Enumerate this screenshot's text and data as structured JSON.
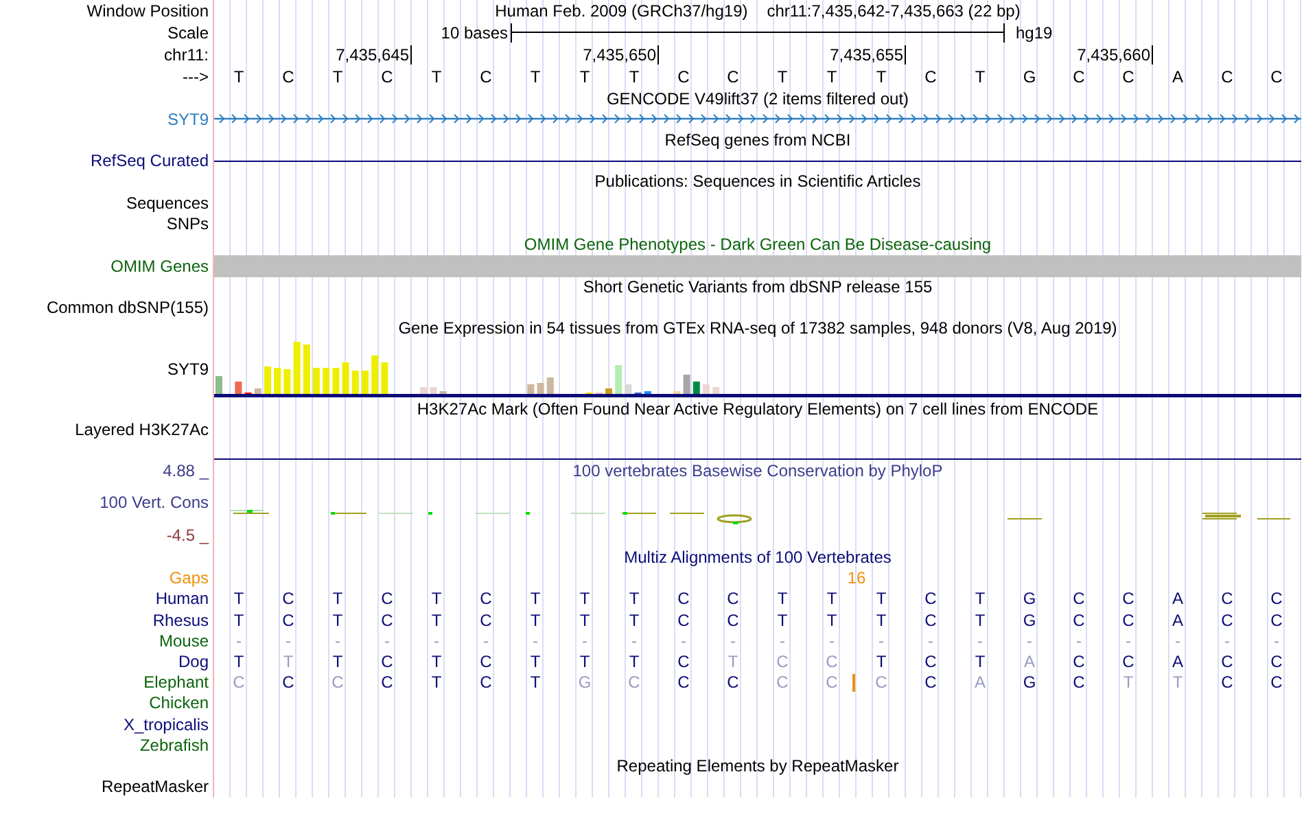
{
  "position": {
    "label": "Window Position",
    "assembly": "Human Feb. 2009 (GRCh37/hg19)",
    "range": "chr11:7,435,642-7,435,663 (22 bp)"
  },
  "scale": {
    "label": "Scale",
    "length": "10 bases",
    "db": "hg19"
  },
  "ruler": {
    "label": "chr11:",
    "ticks": [
      "7,435,645",
      "7,435,650",
      "7,435,655",
      "7,435,660"
    ]
  },
  "strand": {
    "label": "--->",
    "bases": [
      "T",
      "C",
      "T",
      "C",
      "T",
      "C",
      "T",
      "T",
      "T",
      "C",
      "C",
      "T",
      "T",
      "T",
      "C",
      "T",
      "G",
      "C",
      "C",
      "A",
      "C",
      "C"
    ]
  },
  "tracks": [
    {
      "kind": "gene",
      "title": "GENCODE V49lift37 (2 items filtered out)",
      "color": "#000000",
      "labels": [
        {
          "text": "SYT9",
          "color": "#2f7fc1"
        }
      ]
    },
    {
      "kind": "line",
      "title": "RefSeq genes from NCBI",
      "color": "#000000",
      "labels": [
        {
          "text": "RefSeq Curated",
          "color": "#0c0c78"
        }
      ]
    },
    {
      "kind": "empty",
      "title": "Publications: Sequences in Scientific Articles",
      "color": "#000000",
      "labels": [
        {
          "text": "Sequences",
          "color": "#000000"
        },
        {
          "text": "SNPs",
          "color": "#000000"
        }
      ]
    },
    {
      "kind": "bar",
      "title": "OMIM Gene Phenotypes - Dark Green Can Be Disease-causing",
      "color": "#0c640c",
      "labels": [
        {
          "text": "OMIM Genes",
          "color": "#0c640c"
        }
      ]
    },
    {
      "kind": "empty",
      "title": "Short Genetic Variants from dbSNP release 155",
      "color": "#000000",
      "labels": [
        {
          "text": "Common dbSNP(155)",
          "color": "#000000"
        }
      ]
    },
    {
      "kind": "expression",
      "title": "Gene Expression in 54 tissues from GTEx RNA-seq of 17382 samples, 948 donors (V8, Aug 2019)",
      "color": "#000000",
      "labels": [
        {
          "text": "SYT9",
          "color": "#000000"
        }
      ]
    },
    {
      "kind": "signal",
      "title": "H3K27Ac Mark (Often Found Near Active Regulatory Elements) on 7 cell lines from ENCODE",
      "color": "#000000",
      "labels": [
        {
          "text": "Layered H3K27Ac",
          "color": "#000000"
        }
      ]
    },
    {
      "kind": "conservation",
      "title": "100 vertebrates Basewise Conservation by PhyloP",
      "color": "#3c3c8c",
      "labels": [
        {
          "text": "4.88 _",
          "color": "#3c3c8c"
        },
        {
          "text": "100 Vert. Cons",
          "color": "#3c3c8c"
        },
        {
          "text": "-4.5 _",
          "color": "#8c3c3c"
        }
      ]
    },
    {
      "kind": "alignment",
      "title": "Multiz Alignments of 100 Vertebrates",
      "color": "#0c0c78",
      "labels": [
        {
          "text": "Gaps",
          "color": "#f0900c"
        }
      ],
      "species": [
        {
          "name": "Human",
          "color": "#0c0c78",
          "bases": [
            {
              "base": "T",
              "faint": false
            },
            {
              "base": "C",
              "faint": false
            },
            {
              "base": "T",
              "faint": false
            },
            {
              "base": "C",
              "faint": false
            },
            {
              "base": "T",
              "faint": false
            },
            {
              "base": "C",
              "faint": false
            },
            {
              "base": "T",
              "faint": false
            },
            {
              "base": "T",
              "faint": false
            },
            {
              "base": "T",
              "faint": false
            },
            {
              "base": "C",
              "faint": false
            },
            {
              "base": "C",
              "faint": false
            },
            {
              "base": "T",
              "faint": false
            },
            {
              "base": "T",
              "faint": false
            },
            {
              "base": "T",
              "faint": false
            },
            {
              "base": "C",
              "faint": false
            },
            {
              "base": "T",
              "faint": false
            },
            {
              "base": "G",
              "faint": false
            },
            {
              "base": "C",
              "faint": false
            },
            {
              "base": "C",
              "faint": false
            },
            {
              "base": "A",
              "faint": false
            },
            {
              "base": "C",
              "faint": false
            },
            {
              "base": "C",
              "faint": false
            }
          ]
        },
        {
          "name": "Rhesus",
          "color": "#0c0c78",
          "bases": [
            {
              "base": "T",
              "faint": false
            },
            {
              "base": "C",
              "faint": false
            },
            {
              "base": "T",
              "faint": false
            },
            {
              "base": "C",
              "faint": false
            },
            {
              "base": "T",
              "faint": false
            },
            {
              "base": "C",
              "faint": false
            },
            {
              "base": "T",
              "faint": false
            },
            {
              "base": "T",
              "faint": false
            },
            {
              "base": "T",
              "faint": false
            },
            {
              "base": "C",
              "faint": false
            },
            {
              "base": "C",
              "faint": false
            },
            {
              "base": "T",
              "faint": false
            },
            {
              "base": "T",
              "faint": false
            },
            {
              "base": "T",
              "faint": false
            },
            {
              "base": "C",
              "faint": false
            },
            {
              "base": "T",
              "faint": false
            },
            {
              "base": "G",
              "faint": false
            },
            {
              "base": "C",
              "faint": false
            },
            {
              "base": "C",
              "faint": false
            },
            {
              "base": "A",
              "faint": false
            },
            {
              "base": "C",
              "faint": false
            },
            {
              "base": "C",
              "faint": false
            }
          ]
        },
        {
          "name": "Mouse",
          "color": "#0c640c",
          "bases": [
            {
              "base": "-",
              "faint": true
            },
            {
              "base": "-",
              "faint": true
            },
            {
              "base": "-",
              "faint": true
            },
            {
              "base": "-",
              "faint": true
            },
            {
              "base": "-",
              "faint": true
            },
            {
              "base": "-",
              "faint": true
            },
            {
              "base": "-",
              "faint": true
            },
            {
              "base": "-",
              "faint": true
            },
            {
              "base": "-",
              "faint": true
            },
            {
              "base": "-",
              "faint": true
            },
            {
              "base": "-",
              "faint": true
            },
            {
              "base": "-",
              "faint": true
            },
            {
              "base": "-",
              "faint": true
            },
            {
              "base": "-",
              "faint": true
            },
            {
              "base": "-",
              "faint": true
            },
            {
              "base": "-",
              "faint": true
            },
            {
              "base": "-",
              "faint": true
            },
            {
              "base": "-",
              "faint": true
            },
            {
              "base": "-",
              "faint": true
            },
            {
              "base": "-",
              "faint": true
            },
            {
              "base": "-",
              "faint": true
            },
            {
              "base": "-",
              "faint": true
            }
          ]
        },
        {
          "name": "Dog",
          "color": "#0c0c78",
          "bases": [
            {
              "base": "T",
              "faint": false
            },
            {
              "base": "T",
              "faint": true
            },
            {
              "base": "T",
              "faint": false
            },
            {
              "base": "C",
              "faint": false
            },
            {
              "base": "T",
              "faint": false
            },
            {
              "base": "C",
              "faint": false
            },
            {
              "base": "T",
              "faint": false
            },
            {
              "base": "T",
              "faint": false
            },
            {
              "base": "T",
              "faint": false
            },
            {
              "base": "C",
              "faint": false
            },
            {
              "base": "T",
              "faint": true
            },
            {
              "base": "C",
              "faint": true
            },
            {
              "base": "C",
              "faint": true
            },
            {
              "base": "T",
              "faint": false
            },
            {
              "base": "C",
              "faint": false
            },
            {
              "base": "T",
              "faint": false
            },
            {
              "base": "A",
              "faint": true
            },
            {
              "base": "C",
              "faint": false
            },
            {
              "base": "C",
              "faint": false
            },
            {
              "base": "A",
              "faint": false
            },
            {
              "base": "C",
              "faint": false
            },
            {
              "base": "C",
              "faint": false
            }
          ]
        },
        {
          "name": "Elephant",
          "color": "#0c640c",
          "bases": [
            {
              "base": "C",
              "faint": true
            },
            {
              "base": "C",
              "faint": false
            },
            {
              "base": "C",
              "faint": true
            },
            {
              "base": "C",
              "faint": false
            },
            {
              "base": "T",
              "faint": false
            },
            {
              "base": "C",
              "faint": false
            },
            {
              "base": "T",
              "faint": false
            },
            {
              "base": "G",
              "faint": true
            },
            {
              "base": "C",
              "faint": true
            },
            {
              "base": "C",
              "faint": false
            },
            {
              "base": "C",
              "faint": false
            },
            {
              "base": "C",
              "faint": true
            },
            {
              "base": "C",
              "faint": true
            },
            {
              "base": "C",
              "faint": true,
              "insertion": "16"
            },
            {
              "base": "C",
              "faint": false
            },
            {
              "base": "A",
              "faint": true
            },
            {
              "base": "G",
              "faint": false
            },
            {
              "base": "C",
              "faint": false
            },
            {
              "base": "T",
              "faint": true
            },
            {
              "base": "T",
              "faint": true
            },
            {
              "base": "C",
              "faint": false
            },
            {
              "base": "C",
              "faint": false
            }
          ]
        },
        {
          "name": "Chicken",
          "color": "#0c640c"
        },
        {
          "name": "X_tropicalis",
          "color": "#0c0c78"
        },
        {
          "name": "Zebrafish",
          "color": "#0c640c"
        }
      ]
    },
    {
      "kind": "empty",
      "title": "Repeating Elements by RepeatMasker",
      "color": "#000000",
      "labels": [
        {
          "text": "RepeatMasker",
          "color": "#000000"
        }
      ]
    }
  ]
}
